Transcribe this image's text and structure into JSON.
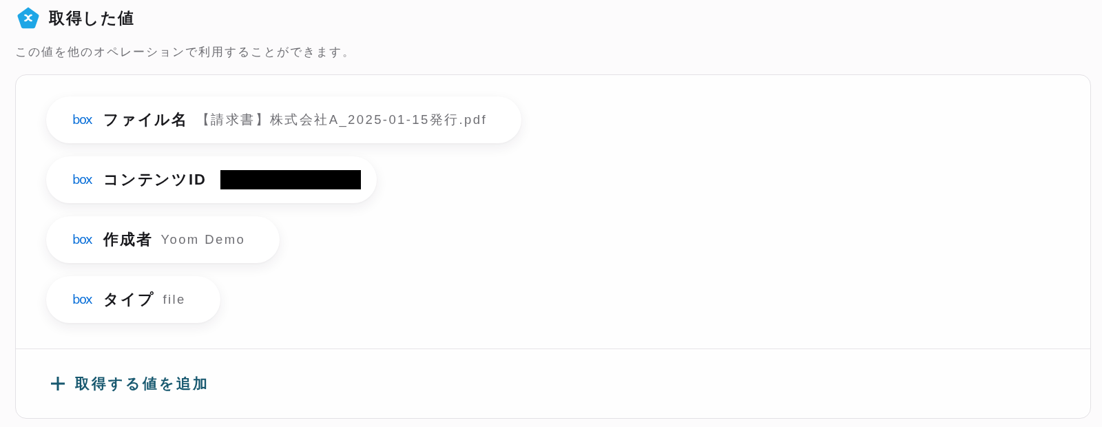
{
  "header": {
    "title": "取得した値",
    "description": "この値を他のオペレーションで利用することができます。"
  },
  "values": [
    {
      "app_logo": "box",
      "label": "ファイル名",
      "value": "【請求書】株式会社A_2025-01-15発行.pdf",
      "redacted": false
    },
    {
      "app_logo": "box",
      "label": "コンテンツID",
      "redacted": true
    },
    {
      "app_logo": "box",
      "label": "作成者",
      "value": "Yoom Demo",
      "redacted": false
    },
    {
      "app_logo": "box",
      "label": "タイプ",
      "value": "file",
      "redacted": false
    }
  ],
  "add_button": {
    "label": "取得する値を追加"
  }
}
